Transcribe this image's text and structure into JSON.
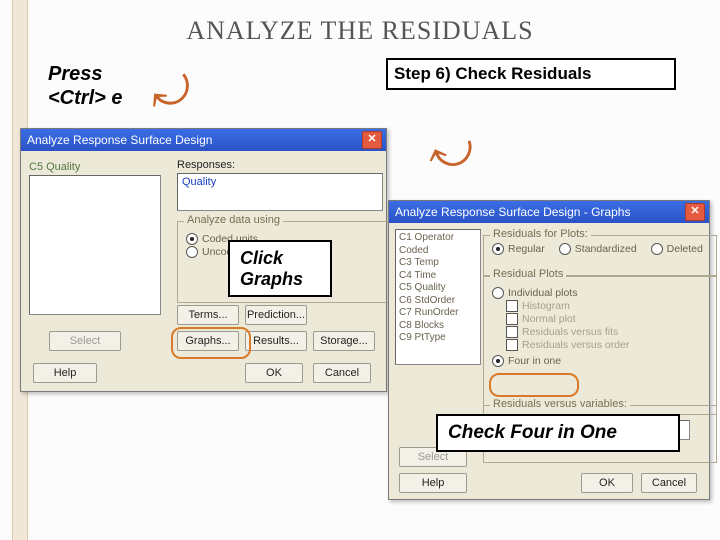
{
  "slide": {
    "title": "ANALYZE THE RESIDUALS",
    "press": "Press\n<Ctrl> e",
    "step": "Step 6)  Check Residuals",
    "callout_click": "Click Graphs",
    "callout_four": "Check Four in One"
  },
  "dlg1": {
    "title": "Analyze Response Surface Design",
    "c5_label": "C5   Quality",
    "responses_label": "Responses:",
    "responses_value": "Quality",
    "analyze_legend": "Analyze data using",
    "radio_coded": "Coded units",
    "radio_uncoded": "Uncoded units",
    "btn_terms": "Terms...",
    "btn_prediction": "Prediction...",
    "btn_graphs": "Graphs...",
    "btn_results": "Results...",
    "btn_storage": "Storage...",
    "btn_select": "Select",
    "btn_help": "Help",
    "btn_ok": "OK",
    "btn_cancel": "Cancel"
  },
  "dlg2": {
    "title": "Analyze Response Surface Design - Graphs",
    "cols": [
      "C1   Operator Coded",
      "C3   Temp",
      "C4   Time",
      "C5   Quality",
      "C6   StdOrder",
      "C7   RunOrder",
      "C8   Blocks",
      "C9   PtType"
    ],
    "resid_legend": "Residuals for Plots:",
    "radio_regular": "Regular",
    "radio_standard": "Standardized",
    "radio_deleted": "Deleted",
    "plots_legend": "Residual Plots",
    "radio_indiv": "Individual plots",
    "chk_hist": "Histogram",
    "chk_normal": "Normal plot",
    "chk_fits": "Residuals versus fits",
    "chk_order": "Residuals versus order",
    "radio_four": "Four in one",
    "vars_legend": "Residuals versus variables:",
    "btn_select": "Select",
    "btn_help": "Help",
    "btn_ok": "OK",
    "btn_cancel": "Cancel"
  }
}
